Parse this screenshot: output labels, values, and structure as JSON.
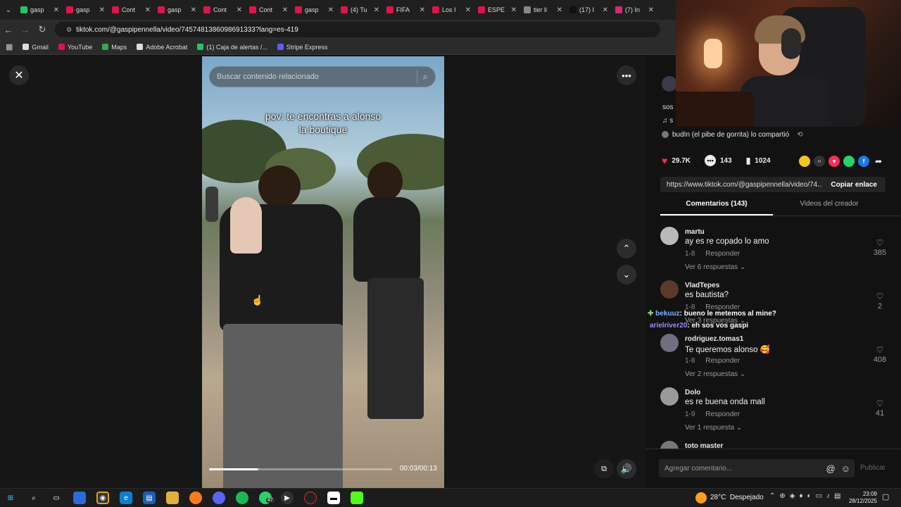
{
  "browser": {
    "tabs": [
      {
        "label": "gasp",
        "color": "#1ec765"
      },
      {
        "label": "gasp",
        "color": "#e0144a"
      },
      {
        "label": "Cont",
        "color": "#e0144a"
      },
      {
        "label": "gasp",
        "color": "#e0144a"
      },
      {
        "label": "Cont",
        "color": "#e0144a"
      },
      {
        "label": "Cont",
        "color": "#e0144a"
      },
      {
        "label": "gasp",
        "color": "#e0144a"
      },
      {
        "label": "(4) Tu",
        "color": "#e0144a"
      },
      {
        "label": "FIFA",
        "color": "#e0144a"
      },
      {
        "label": "Los I",
        "color": "#e0144a"
      },
      {
        "label": "ESPE",
        "color": "#e0144a"
      },
      {
        "label": "tier li",
        "color": "#888888"
      },
      {
        "label": "(17) I",
        "color": "#111111"
      },
      {
        "label": "(7) In",
        "color": "#d62976"
      }
    ],
    "url": "tiktok.com/@gaspipennella/video/7457481386098691333?lang=es-419",
    "bookmarks": [
      {
        "label": "Gmail",
        "color": "#dddddd"
      },
      {
        "label": "YouTube",
        "color": "#e0144a"
      },
      {
        "label": "Maps",
        "color": "#34a853"
      },
      {
        "label": "Adobe Acrobat",
        "color": "#dddddd"
      },
      {
        "label": "(1) Caja de alertas /...",
        "color": "#1ec765"
      },
      {
        "label": "Stripe Express",
        "color": "#635bff"
      }
    ]
  },
  "video": {
    "search_placeholder": "Buscar contenido relacionado",
    "caption_line1": "pov: te encontras a alonso",
    "caption_line2": "la boutique",
    "time": "00:03/00:13",
    "progress_fraction": 0.27
  },
  "panel": {
    "author_short": "sos",
    "music_short": "s",
    "shared_by": "budIn (el pibe de gorrita) lo compartió",
    "likes": "29.7K",
    "comments": "143",
    "saves": "1024",
    "link": "https://www.tiktok.com/@gaspipennella/video/74...",
    "copy_link": "Copiar enlace",
    "tab_comments": "Comentarios (143)",
    "tab_videos": "Videos del creador",
    "comment_placeholder": "Agregar comentario...",
    "publish": "Publicar",
    "comments_list": [
      {
        "name": "martu",
        "text": "ay es re copado lo amo",
        "date": "1-8",
        "reply": "Responder",
        "replies": "Ver 6 respuestas",
        "likes": "385",
        "avatar": "#b9b9b9"
      },
      {
        "name": "VladTepes",
        "text": "es bautista?",
        "date": "1-8",
        "reply": "Responder",
        "replies": "Ver 3 respuestas",
        "likes": "2",
        "avatar": "#5a3b2a"
      },
      {
        "name": "rodriguez.tomas1",
        "text": "Te queremos alonso 🥰",
        "date": "1-8",
        "reply": "Responder",
        "replies": "Ver 2 respuestas",
        "likes": "408",
        "avatar": "#6f6f80"
      },
      {
        "name": "Dolo",
        "text": "es re buena onda mall",
        "date": "1-9",
        "reply": "Responder",
        "replies": "Ver 1 respuesta",
        "likes": "41",
        "avatar": "#9a9a9a"
      },
      {
        "name": "toto master",
        "text": "",
        "date": "",
        "reply": "",
        "replies": "",
        "likes": "",
        "avatar": "#777777"
      }
    ]
  },
  "chat_overlay": [
    {
      "user": "bekuuz",
      "msg": ": bueno le metemos al mine?",
      "color": "#7fb2ff"
    },
    {
      "user": "arielriver20",
      "msg": ": eh sos vos gaspi",
      "color": "#9a8cff"
    }
  ],
  "taskbar": {
    "weather": "28°C  Despejado",
    "time": "23:09",
    "date": "28/12/2025",
    "badge": "47"
  }
}
